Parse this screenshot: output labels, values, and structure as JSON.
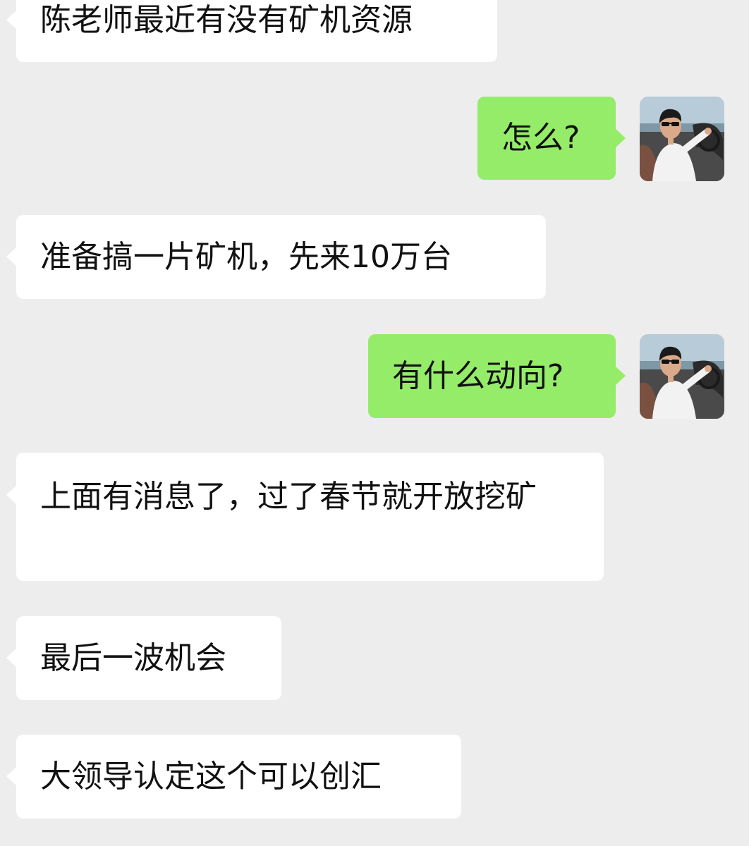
{
  "messages": [
    {
      "side": "left",
      "text": "陈老师最近有没有矿机资源"
    },
    {
      "side": "right",
      "text": "怎么?"
    },
    {
      "side": "left",
      "text": "准备搞一片矿机，先来10万台"
    },
    {
      "side": "right",
      "text": "有什么动向?"
    },
    {
      "side": "left",
      "text": "上面有消息了，过了春节就开放挖矿"
    },
    {
      "side": "left",
      "text": "最后一波机会"
    },
    {
      "side": "left",
      "text": "大领导认定这个可以创汇"
    }
  ],
  "avatar_icon": "user-avatar-photo",
  "colors": {
    "background": "#ededed",
    "incoming_bubble": "#ffffff",
    "outgoing_bubble": "#95ec69",
    "text": "#111111"
  }
}
